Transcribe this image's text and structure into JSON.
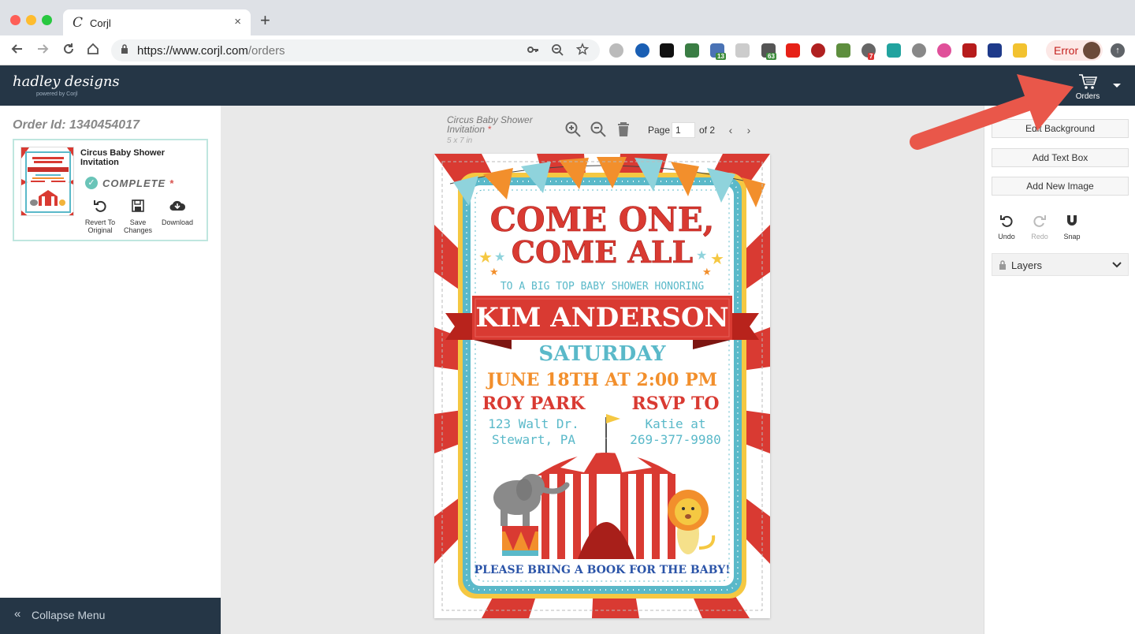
{
  "browser": {
    "tab_title": "Corjl",
    "favicon_letter": "C",
    "tab_close": "×",
    "new_tab": "+",
    "url_main": "https://www.corjl.com",
    "url_path": "/orders",
    "profile_status": "Error",
    "extension_badges": [
      "13",
      "63",
      "7"
    ]
  },
  "app": {
    "brand_name": "hadley designs",
    "brand_sub": "powered by Corjl",
    "orders_label": "Orders"
  },
  "left_panel": {
    "order_id": "Order Id: 1340454017",
    "card_title": "Circus Baby Shower Invitation",
    "status": "COMPLETE",
    "status_marker": "*",
    "actions": [
      {
        "label": "Revert To Original",
        "icon": "undo-icon"
      },
      {
        "label": "Save Changes",
        "icon": "save-icon"
      },
      {
        "label": "Download",
        "icon": "cloud-download-icon"
      }
    ],
    "collapse_label": "Collapse Menu",
    "collapse_icon": "«"
  },
  "editor": {
    "doc_title": "Circus Baby Shower Invitation",
    "doc_title_marker": "*",
    "doc_size": "5 x 7 in",
    "page_label": "Page",
    "page_value": "1",
    "page_of": "of 2"
  },
  "invitation": {
    "headline_1": "COME ONE,",
    "headline_2": "COME ALL",
    "subtitle": "TO A BIG TOP BABY SHOWER HONORING",
    "honoree": "KIM ANDERSON",
    "day": "SATURDAY",
    "date_time": "JUNE 18TH AT 2:00 PM",
    "location_title": "ROY PARK",
    "location_line1": "123 Walt Dr.",
    "location_line2": "Stewart, PA",
    "rsvp_title": "RSVP TO",
    "rsvp_line1": "Katie at",
    "rsvp_line2": "269-377-9980",
    "footer": "PLEASE BRING A BOOK FOR THE BABY!"
  },
  "right_panel": {
    "buttons": [
      "Edit Background",
      "Add Text Box",
      "Add New Image"
    ],
    "actions": [
      {
        "label": "Undo",
        "enabled": true
      },
      {
        "label": "Redo",
        "enabled": false
      },
      {
        "label": "Snap",
        "enabled": true
      }
    ],
    "layers_label": "Layers"
  },
  "colors": {
    "header_bg": "#253646",
    "accent_teal": "#6ac4b8",
    "circus_red": "#d93a32",
    "circus_blue": "#5ab9c9",
    "circus_orange": "#f28f2c",
    "callout_arrow": "#e9574a"
  }
}
